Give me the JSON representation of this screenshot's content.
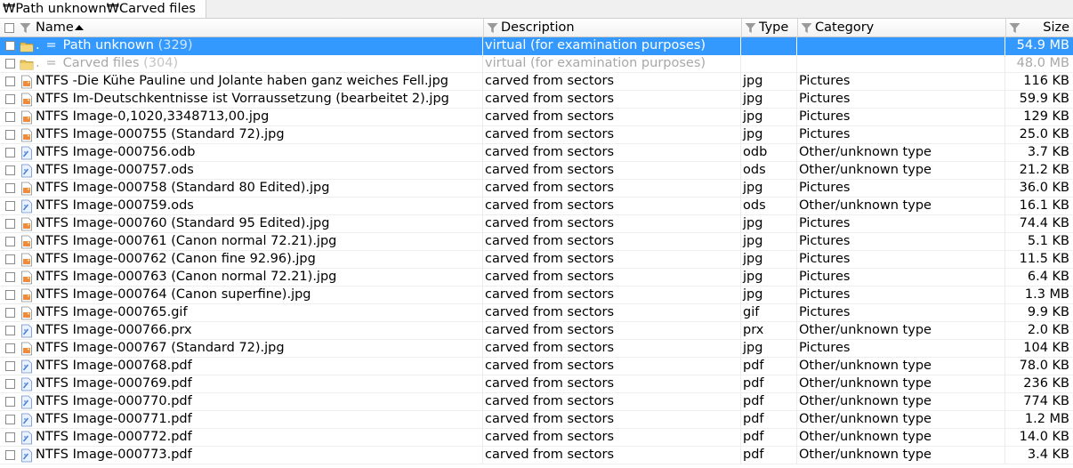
{
  "path": "₩Path unknown₩Carved files",
  "columns": {
    "name": "Name",
    "description": "Description",
    "type": "Type",
    "category": "Category",
    "size": "Size"
  },
  "colors": {
    "selection": "#3399ff",
    "dim_text": "#a8a8a8"
  },
  "rows": [
    {
      "kind": "folder",
      "state": "selected",
      "prefix": ".",
      "eq": "=",
      "name": "Path unknown",
      "count": "(329)",
      "description": "virtual (for examination purposes)",
      "type": "",
      "category": "",
      "size": "54.9 MB"
    },
    {
      "kind": "folder",
      "state": "dim",
      "prefix": ".",
      "eq": "=",
      "name": "Carved files",
      "count": "(304)",
      "description": "virtual (for examination purposes)",
      "type": "",
      "category": "",
      "size": "48.0 MB"
    },
    {
      "kind": "image",
      "name": "NTFS -Die Kühe Pauline und Jolante haben ganz weiches Fell.jpg",
      "description": "carved from sectors",
      "type": "jpg",
      "category": "Pictures",
      "size": "116 KB"
    },
    {
      "kind": "image",
      "name": "NTFS Im-Deutschkentnisse ist Vorraussetzung (bearbeitet 2).jpg",
      "description": "carved from sectors",
      "type": "jpg",
      "category": "Pictures",
      "size": "59.9 KB"
    },
    {
      "kind": "image",
      "name": "NTFS Image-0,1020,3348713,00.jpg",
      "description": "carved from sectors",
      "type": "jpg",
      "category": "Pictures",
      "size": "129 KB"
    },
    {
      "kind": "image",
      "name": "NTFS Image-000755 (Standard 72).jpg",
      "description": "carved from sectors",
      "type": "jpg",
      "category": "Pictures",
      "size": "25.0 KB"
    },
    {
      "kind": "doc",
      "name": "NTFS Image-000756.odb",
      "description": "carved from sectors",
      "type": "odb",
      "category": "Other/unknown type",
      "size": "3.7 KB"
    },
    {
      "kind": "doc",
      "name": "NTFS Image-000757.ods",
      "description": "carved from sectors",
      "type": "ods",
      "category": "Other/unknown type",
      "size": "21.2 KB"
    },
    {
      "kind": "image",
      "name": "NTFS Image-000758 (Standard 80 Edited).jpg",
      "description": "carved from sectors",
      "type": "jpg",
      "category": "Pictures",
      "size": "36.0 KB"
    },
    {
      "kind": "doc",
      "name": "NTFS Image-000759.ods",
      "description": "carved from sectors",
      "type": "ods",
      "category": "Other/unknown type",
      "size": "16.1 KB"
    },
    {
      "kind": "image",
      "name": "NTFS Image-000760 (Standard 95 Edited).jpg",
      "description": "carved from sectors",
      "type": "jpg",
      "category": "Pictures",
      "size": "74.4 KB"
    },
    {
      "kind": "image",
      "name": "NTFS Image-000761 (Canon normal 72.21).jpg",
      "description": "carved from sectors",
      "type": "jpg",
      "category": "Pictures",
      "size": "5.1 KB"
    },
    {
      "kind": "image",
      "name": "NTFS Image-000762 (Canon fine 92.96).jpg",
      "description": "carved from sectors",
      "type": "jpg",
      "category": "Pictures",
      "size": "11.5 KB"
    },
    {
      "kind": "image",
      "name": "NTFS Image-000763 (Canon normal 72.21).jpg",
      "description": "carved from sectors",
      "type": "jpg",
      "category": "Pictures",
      "size": "6.4 KB"
    },
    {
      "kind": "image",
      "name": "NTFS Image-000764 (Canon superfine).jpg",
      "description": "carved from sectors",
      "type": "jpg",
      "category": "Pictures",
      "size": "1.3 MB"
    },
    {
      "kind": "image",
      "name": "NTFS Image-000765.gif",
      "description": "carved from sectors",
      "type": "gif",
      "category": "Pictures",
      "size": "9.9 KB"
    },
    {
      "kind": "doc",
      "name": "NTFS Image-000766.prx",
      "description": "carved from sectors",
      "type": "prx",
      "category": "Other/unknown type",
      "size": "2.0 KB"
    },
    {
      "kind": "image",
      "name": "NTFS Image-000767 (Standard 72).jpg",
      "description": "carved from sectors",
      "type": "jpg",
      "category": "Pictures",
      "size": "104 KB"
    },
    {
      "kind": "doc",
      "name": "NTFS Image-000768.pdf",
      "description": "carved from sectors",
      "type": "pdf",
      "category": "Other/unknown type",
      "size": "78.0 KB"
    },
    {
      "kind": "doc",
      "name": "NTFS Image-000769.pdf",
      "description": "carved from sectors",
      "type": "pdf",
      "category": "Other/unknown type",
      "size": "236 KB"
    },
    {
      "kind": "doc",
      "name": "NTFS Image-000770.pdf",
      "description": "carved from sectors",
      "type": "pdf",
      "category": "Other/unknown type",
      "size": "774 KB"
    },
    {
      "kind": "doc",
      "name": "NTFS Image-000771.pdf",
      "description": "carved from sectors",
      "type": "pdf",
      "category": "Other/unknown type",
      "size": "1.2 MB"
    },
    {
      "kind": "doc",
      "name": "NTFS Image-000772.pdf",
      "description": "carved from sectors",
      "type": "pdf",
      "category": "Other/unknown type",
      "size": "14.0 KB"
    },
    {
      "kind": "doc",
      "name": "NTFS Image-000773.pdf",
      "description": "carved from sectors",
      "type": "pdf",
      "category": "Other/unknown type",
      "size": "3.4 KB"
    }
  ]
}
